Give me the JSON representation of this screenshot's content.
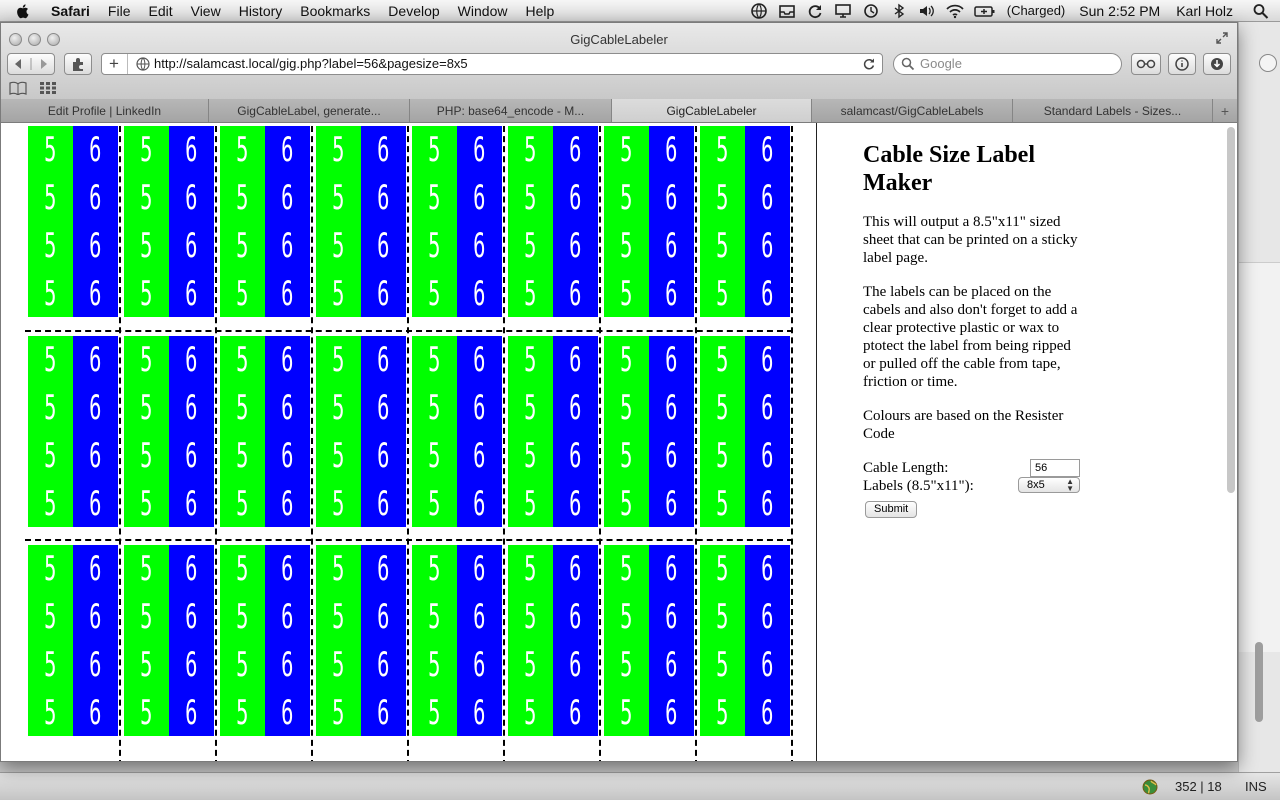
{
  "menubar": {
    "app_name": "Safari",
    "menus": [
      "File",
      "Edit",
      "View",
      "History",
      "Bookmarks",
      "Develop",
      "Window",
      "Help"
    ],
    "battery_text": "(Charged)",
    "clock": "Sun 2:52 PM",
    "user": "Karl Holz"
  },
  "window": {
    "title": "GigCableLabeler",
    "url": "http://salamcast.local/gig.php?label=56&pagesize=8x5",
    "search_placeholder": "Google"
  },
  "tabs": [
    {
      "label": "Edit Profile | LinkedIn",
      "active": false
    },
    {
      "label": "GigCableLabel, generate...",
      "active": false
    },
    {
      "label": "PHP: base64_encode - M...",
      "active": false
    },
    {
      "label": "GigCableLabeler",
      "active": true
    },
    {
      "label": "salamcast/GigCableLabels",
      "active": false
    },
    {
      "label": "Standard Labels - Sizes...",
      "active": false
    }
  ],
  "labels": {
    "left_digit": "5",
    "right_digit": "6",
    "left_color": "#00ff00",
    "right_color": "#0000ff",
    "columns": 8,
    "rows_visible": 3
  },
  "sidebar": {
    "heading": "Cable Size Label Maker",
    "para1": "This will output a 8.5\"x11\" sized sheet that can be printed on a sticky label page.",
    "para2": "The labels can be placed on the cabels and also don't forget to add a clear protective plastic or wax to ptotect the label from being ripped or pulled off the cable from tape, friction or time.",
    "para3": "Colours are based on the Resister Code",
    "length_label": "Cable Length:",
    "labels_label": "Labels (8.5\"x11\"):",
    "length_value": "56",
    "size_value": "8x5",
    "submit": "Submit"
  },
  "statusbar": {
    "position": "352 | 18",
    "mode": "INS"
  }
}
